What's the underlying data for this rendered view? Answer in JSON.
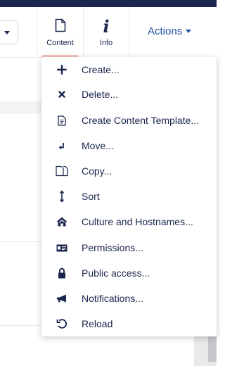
{
  "header": {
    "apps": [
      {
        "label": "Content",
        "icon": "document-icon",
        "active": true
      },
      {
        "label": "Info",
        "icon": "info-icon",
        "active": false
      }
    ],
    "actions_label": "Actions"
  },
  "menu": {
    "items": [
      {
        "label": "Create...",
        "icon": "add-icon"
      },
      {
        "label": "Delete...",
        "icon": "delete-icon"
      },
      {
        "label": "Create Content Template...",
        "icon": "document-template-icon"
      },
      {
        "label": "Move...",
        "icon": "move-icon"
      },
      {
        "label": "Copy...",
        "icon": "copy-icon"
      },
      {
        "label": "Sort",
        "icon": "sort-icon"
      },
      {
        "label": "Culture and Hostnames...",
        "icon": "home-icon"
      },
      {
        "label": "Permissions...",
        "icon": "permissions-icon"
      },
      {
        "label": "Public access...",
        "icon": "lock-icon"
      },
      {
        "label": "Notifications...",
        "icon": "megaphone-icon"
      },
      {
        "label": "Reload",
        "icon": "reload-icon"
      }
    ]
  },
  "colors": {
    "navy": "#1b264f",
    "accent_blue": "#2152a3",
    "active_tab_indicator": "#f5c1bc"
  }
}
